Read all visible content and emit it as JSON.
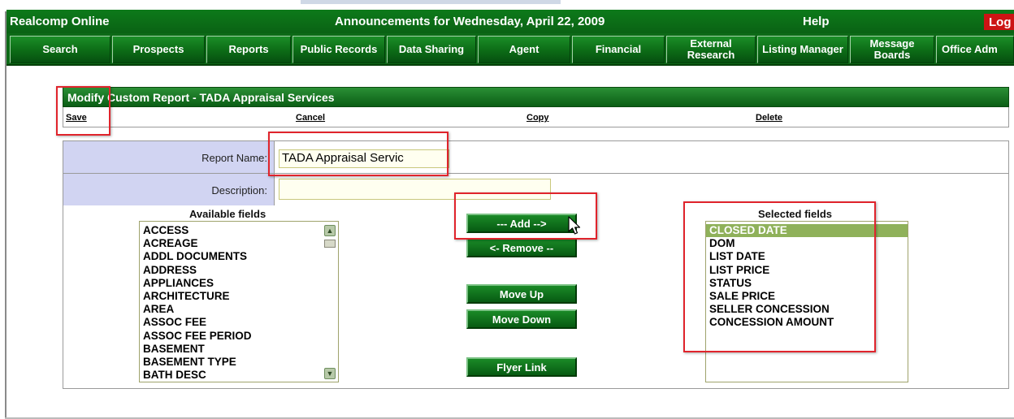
{
  "topbar": {
    "brand": "Realcomp Online",
    "announcement": "Announcements for Wednesday, April 22, 2009",
    "help": "Help",
    "logout": "Log"
  },
  "nav": [
    {
      "label": "Search"
    },
    {
      "label": "Prospects"
    },
    {
      "label": "Reports"
    },
    {
      "label": "Public Records"
    },
    {
      "label": "Data Sharing"
    },
    {
      "label": "Agent"
    },
    {
      "label": "Financial"
    },
    {
      "label": "External Research"
    },
    {
      "label": "Listing Manager"
    },
    {
      "label": "Message Boards"
    },
    {
      "label": "Office Adm"
    }
  ],
  "panel": {
    "title": "Modify Custom Report - TADA Appraisal Services",
    "actions": {
      "save": "Save",
      "cancel": "Cancel",
      "copy": "Copy",
      "delete": "Delete"
    }
  },
  "form": {
    "report_name_label": "Report Name:",
    "report_name_value": "TADA Appraisal Servic",
    "description_label": "Description:",
    "description_value": ""
  },
  "available": {
    "title": "Available fields",
    "items": [
      "ACCESS",
      "ACREAGE",
      "ADDL DOCUMENTS",
      "ADDRESS",
      "APPLIANCES",
      "ARCHITECTURE",
      "AREA",
      "ASSOC FEE",
      "ASSOC FEE PERIOD",
      "BASEMENT",
      "BASEMENT TYPE",
      "BATH DESC"
    ]
  },
  "buttons": {
    "add": "--- Add -->",
    "remove": "<- Remove --",
    "move_up": "Move Up",
    "move_down": "Move Down",
    "flyer_link": "Flyer Link"
  },
  "selected": {
    "title": "Selected fields",
    "items": [
      "CLOSED DATE",
      "DOM",
      "LIST DATE",
      "LIST PRICE",
      "STATUS",
      "SALE PRICE",
      "SELLER CONCESSION",
      "CONCESSION AMOUNT"
    ],
    "selected_item": "CLOSED DATE"
  },
  "colors": {
    "brand_green": "#0b6a16",
    "label_bg": "#d1d4f2",
    "selected_bg": "#8fb15a",
    "highlight_red": "#e0242c",
    "logout_red": "#cc1414"
  }
}
